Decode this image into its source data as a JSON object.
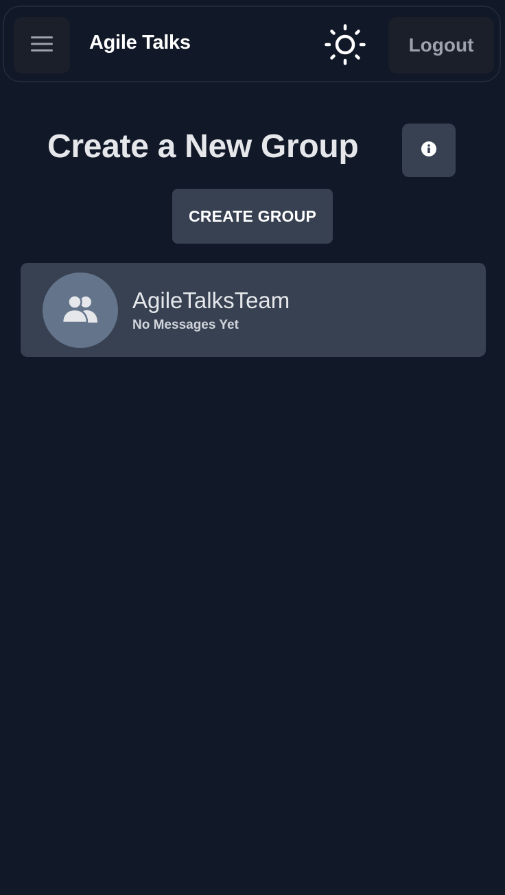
{
  "header": {
    "app_title": "Agile Talks",
    "menu_icon": "hamburger-menu-icon",
    "theme_icon": "sun-icon",
    "logout_label": "Logout"
  },
  "main": {
    "title": "Create a New Group",
    "info_icon": "info-icon",
    "create_group_label": "CREATE GROUP"
  },
  "groups": [
    {
      "name": "AgileTalksTeam",
      "last_message": "No Messages Yet",
      "icon": "users-icon"
    }
  ],
  "colors": {
    "background": "#111827",
    "surface": "#374151",
    "avatar": "#64748b"
  }
}
